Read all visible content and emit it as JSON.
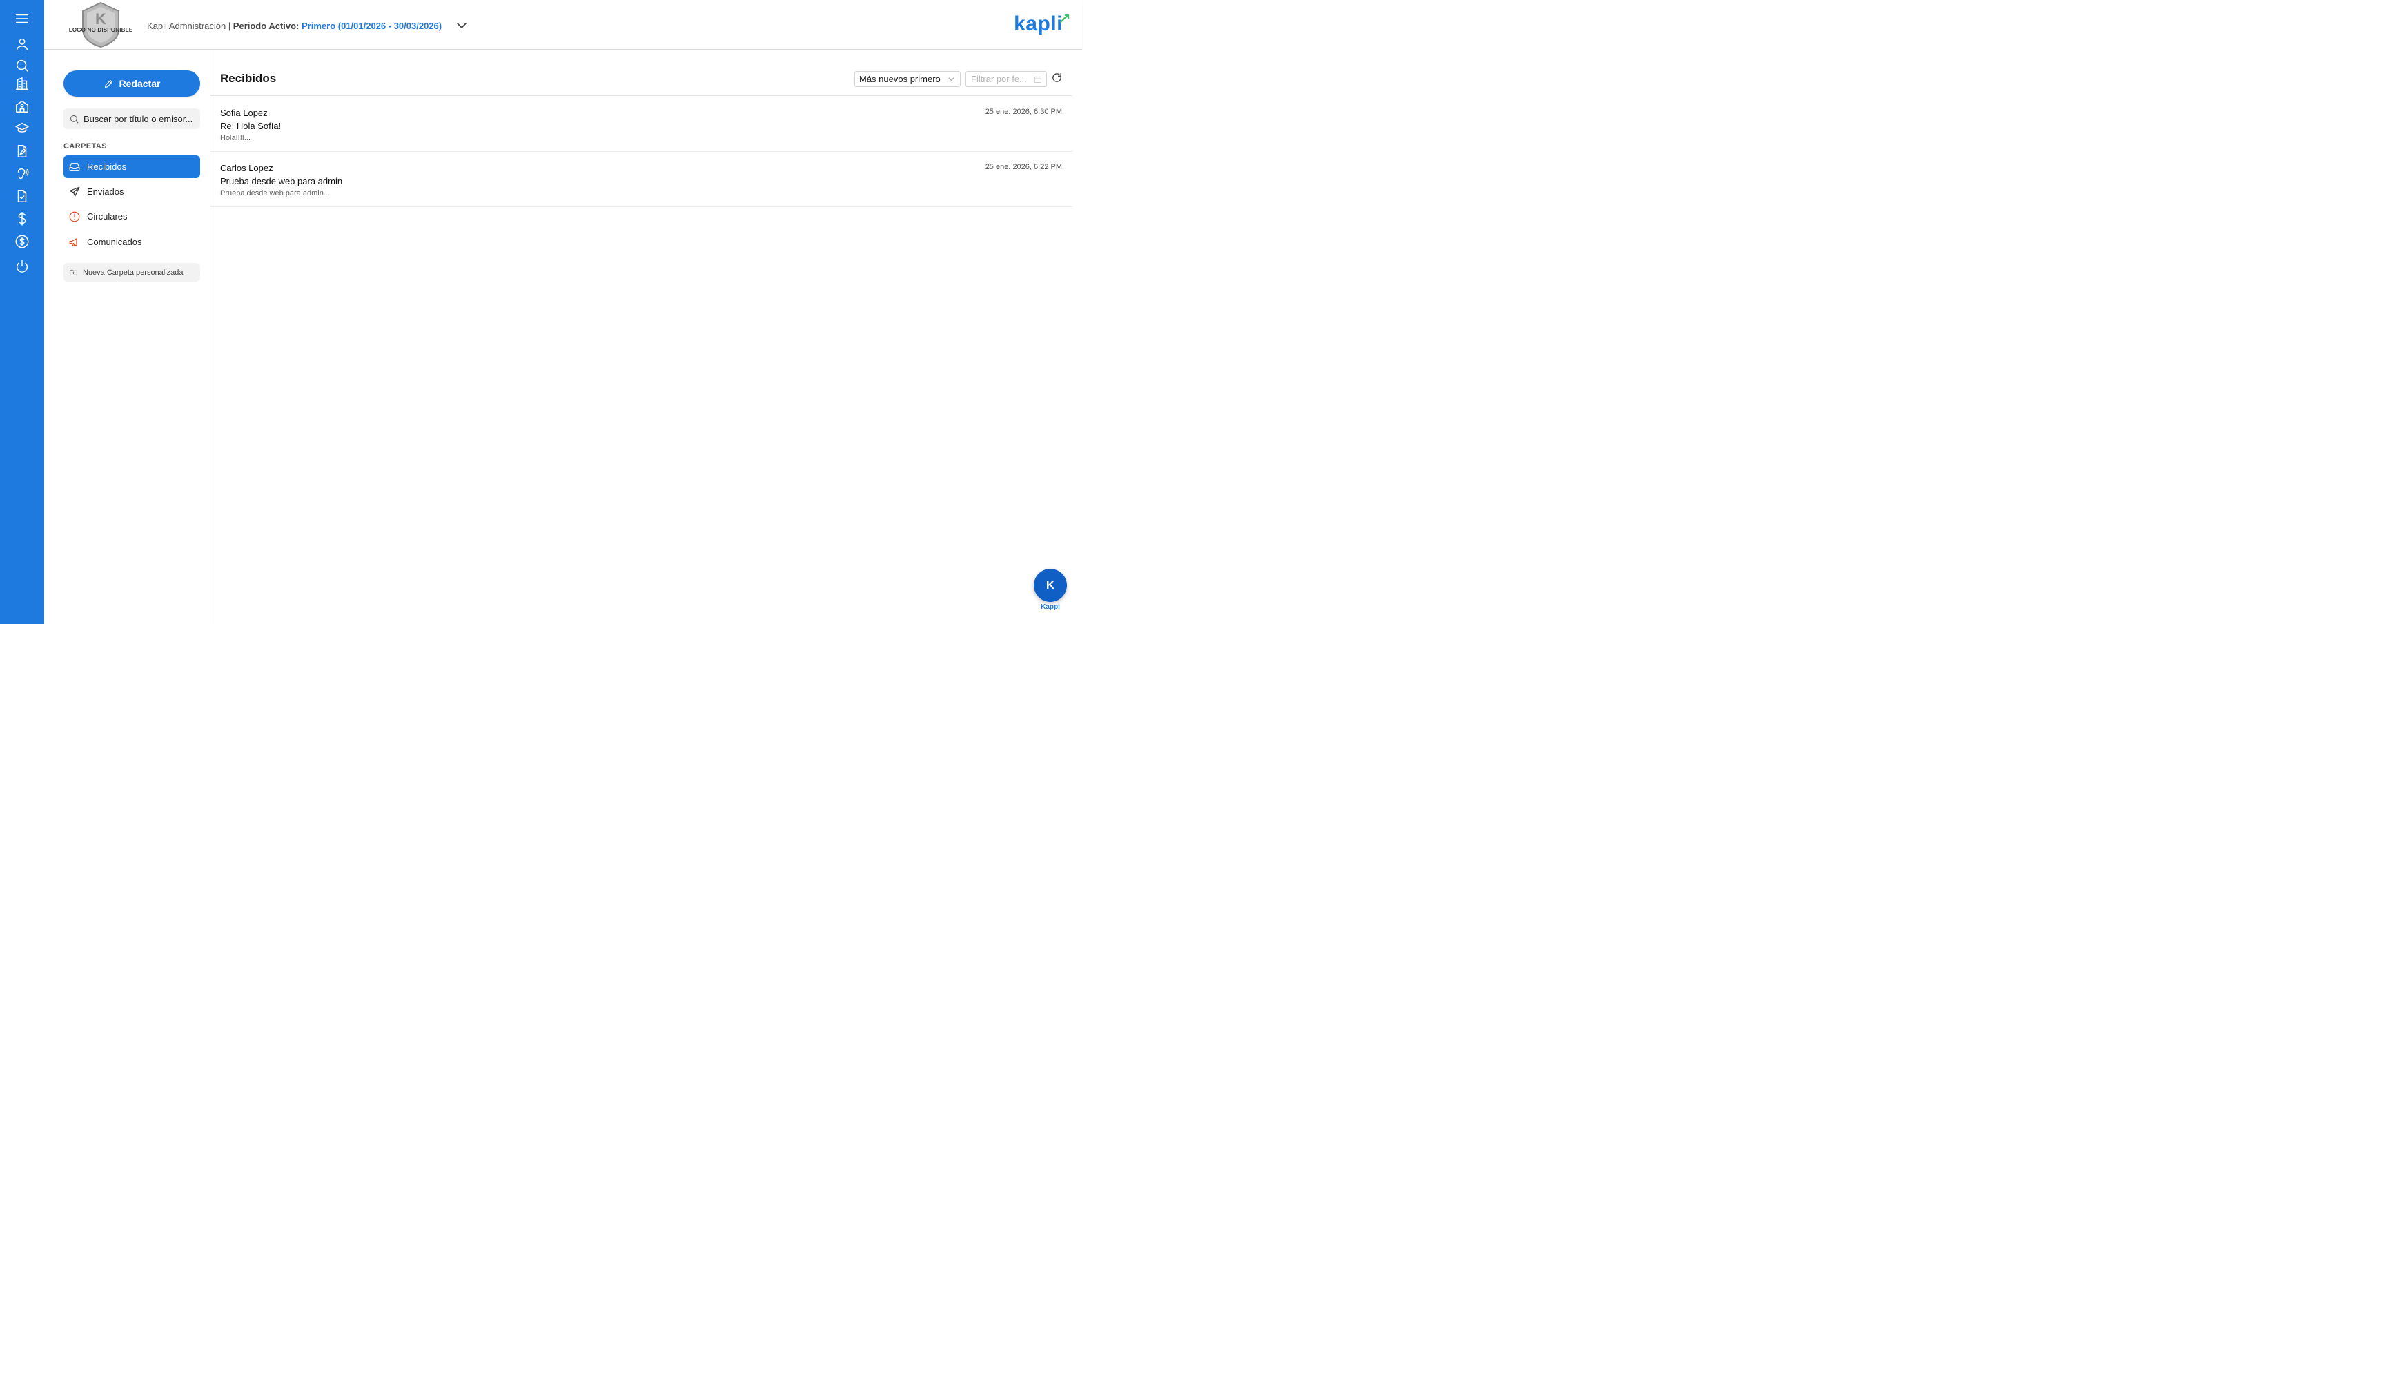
{
  "header": {
    "logo_placeholder": "LOGO NO DISPONIBLE",
    "app_name": "Kapli Admnistración |",
    "period_label": "Periodo Activo:",
    "period_value": "Primero (01/01/2026 - 30/03/2026)",
    "brand": "kapli"
  },
  "rail": {
    "icons": [
      "menu-icon",
      "user-icon",
      "search-icon",
      "building-icon",
      "school-icon",
      "graduation-cap-icon",
      "document-edit-icon",
      "hearing-icon",
      "document-check-icon",
      "dollar-icon",
      "dollar-circle-icon",
      "power-icon"
    ]
  },
  "sidebar": {
    "compose_label": "Redactar",
    "search_placeholder": "Buscar por título o emisor...",
    "folders_label": "CARPETAS",
    "folders": [
      {
        "label": "Recibidos",
        "icon": "inbox-icon",
        "active": true
      },
      {
        "label": "Enviados",
        "icon": "send-icon",
        "active": false
      },
      {
        "label": "Circulares",
        "icon": "alert-circle-icon",
        "active": false,
        "color": "#e0501f"
      },
      {
        "label": "Comunicados",
        "icon": "megaphone-icon",
        "active": false,
        "color": "#e0501f"
      }
    ],
    "new_folder_label": "Nueva Carpeta personalizada"
  },
  "main": {
    "title": "Recibidos",
    "sort_value": "Más nuevos primero",
    "date_filter_placeholder": "Filtrar por fe...",
    "messages": [
      {
        "sender": "Sofia Lopez",
        "subject": "Re: Hola Sofía!",
        "preview": "Hola!!!!...",
        "date": "25 ene. 2026, 6:30 PM"
      },
      {
        "sender": "Carlos Lopez",
        "subject": "Prueba desde web para admin",
        "preview": "Prueba desde web para admin...",
        "date": "25 ene. 2026, 6:22 PM"
      }
    ]
  },
  "assistant": {
    "initial": "K",
    "label": "Kappi"
  },
  "colors": {
    "primary": "#1f7ae0",
    "accent_orange": "#e0501f"
  }
}
